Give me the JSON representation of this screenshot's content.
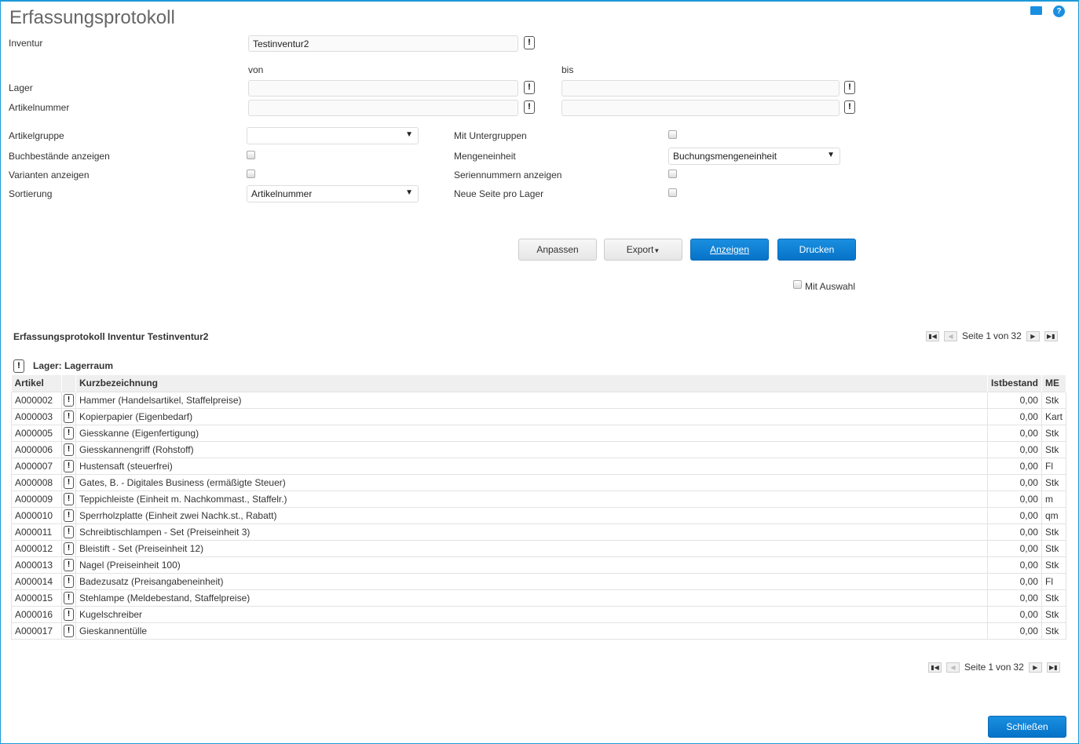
{
  "title": "Erfassungsprotokoll",
  "form": {
    "inventur_label": "Inventur",
    "inventur_value": "Testinventur2",
    "von_label": "von",
    "bis_label": "bis",
    "lager_label": "Lager",
    "artikelnummer_label": "Artikelnummer",
    "artikelgruppe_label": "Artikelgruppe",
    "artikelgruppe_value": "",
    "buchbestaende_label": "Buchbestände anzeigen",
    "varianten_label": "Varianten anzeigen",
    "sortierung_label": "Sortierung",
    "sortierung_value": "Artikelnummer",
    "untergruppen_label": "Mit Untergruppen",
    "mengeneinheit_label": "Mengeneinheit",
    "mengeneinheit_value": "Buchungsmengeneinheit",
    "seriennummern_label": "Seriennummern anzeigen",
    "neue_seite_label": "Neue Seite pro Lager",
    "mit_auswahl_label": "Mit Auswahl"
  },
  "buttons": {
    "anpassen": "Anpassen",
    "export": "Export",
    "anzeigen": "Anzeigen",
    "drucken": "Drucken",
    "schliessen": "Schließen"
  },
  "report": {
    "title": "Erfassungsprotokoll Inventur Testinventur2",
    "pager": {
      "prefix": "Seite",
      "page": "1",
      "of": "von",
      "total": "32"
    },
    "group": "Lager: Lagerraum",
    "columns": [
      "Artikel",
      "Kurzbezeichnung",
      "Istbestand",
      "ME"
    ],
    "rows": [
      [
        "A000002",
        "Hammer (Handelsartikel, Staffelpreise)",
        "0,00",
        "Stk"
      ],
      [
        "A000003",
        "Kopierpapier (Eigenbedarf)",
        "0,00",
        "Kart"
      ],
      [
        "A000005",
        "Giesskanne (Eigenfertigung)",
        "0,00",
        "Stk"
      ],
      [
        "A000006",
        "Giesskannengriff (Rohstoff)",
        "0,00",
        "Stk"
      ],
      [
        "A000007",
        "Hustensaft (steuerfrei)",
        "0,00",
        "Fl"
      ],
      [
        "A000008",
        "Gates, B. - Digitales Business (ermäßigte Steuer)",
        "0,00",
        "Stk"
      ],
      [
        "A000009",
        "Teppichleiste (Einheit m. Nachkommast., Staffelr.)",
        "0,00",
        "m"
      ],
      [
        "A000010",
        "Sperrholzplatte (Einheit zwei Nachk.st., Rabatt)",
        "0,00",
        "qm"
      ],
      [
        "A000011",
        "Schreibtischlampen - Set (Preiseinheit 3)",
        "0,00",
        "Stk"
      ],
      [
        "A000012",
        "Bleistift - Set (Preiseinheit 12)",
        "0,00",
        "Stk"
      ],
      [
        "A000013",
        "Nagel (Preiseinheit 100)",
        "0,00",
        "Stk"
      ],
      [
        "A000014",
        "Badezusatz (Preisangabeneinheit)",
        "0,00",
        "Fl"
      ],
      [
        "A000015",
        "Stehlampe (Meldebestand, Staffelpreise)",
        "0,00",
        "Stk"
      ],
      [
        "A000016",
        "Kugelschreiber",
        "0,00",
        "Stk"
      ],
      [
        "A000017",
        "Gieskannentülle",
        "0,00",
        "Stk"
      ]
    ]
  }
}
